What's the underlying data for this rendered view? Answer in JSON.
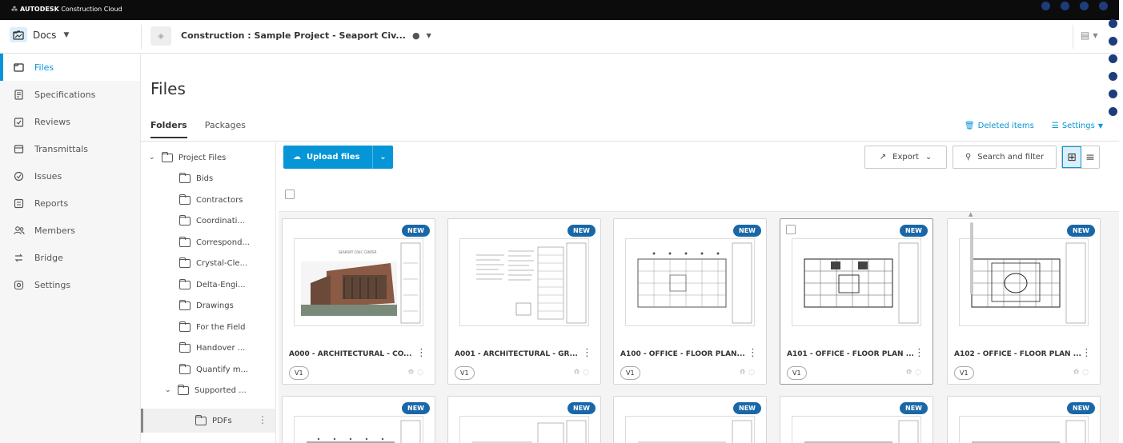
{
  "brand": {
    "mark": "⁂",
    "name": "AUTODESK",
    "product": "Construction Cloud"
  },
  "header": {
    "module_label": "Docs",
    "project_name": "Construction : Sample Project - Seaport Civ...",
    "project_globe_icon": "globe-icon",
    "user_icon": "user-menu-icon"
  },
  "sidebar": {
    "items": [
      {
        "label": "Files",
        "icon": "file-icon",
        "active": true
      },
      {
        "label": "Specifications",
        "icon": "specifications-icon"
      },
      {
        "label": "Reviews",
        "icon": "reviews-icon"
      },
      {
        "label": "Transmittals",
        "icon": "transmittals-icon"
      },
      {
        "label": "Issues",
        "icon": "issues-icon"
      },
      {
        "label": "Reports",
        "icon": "reports-icon"
      },
      {
        "label": "Members",
        "icon": "members-icon"
      },
      {
        "label": "Bridge",
        "icon": "bridge-icon"
      },
      {
        "label": "Settings",
        "icon": "gear-icon"
      }
    ]
  },
  "main": {
    "title": "Files",
    "tabs": [
      {
        "label": "Folders",
        "active": true
      },
      {
        "label": "Packages"
      }
    ],
    "deleted_items": "Deleted items",
    "settings": "Settings"
  },
  "tree": {
    "root": "Project Files",
    "folders": [
      "Bids",
      "Contractors",
      "Coordinati...",
      "Correspond...",
      "Crystal-Cle...",
      "Delta-Engi...",
      "Drawings",
      "For the Field",
      "Handover ...",
      "Quantify m..."
    ],
    "expanded": "Supported ...",
    "child": "PDFs"
  },
  "toolbar": {
    "upload": "Upload files",
    "export": "Export",
    "search": "Search and filter"
  },
  "cards": [
    {
      "name": "A000 - ARCHITECTURAL - CO...",
      "version": "V1",
      "badge": "NEW",
      "thumb": "render"
    },
    {
      "name": "A001 - ARCHITECTURAL - GR...",
      "version": "V1",
      "badge": "NEW",
      "thumb": "notes"
    },
    {
      "name": "A100 - OFFICE - FLOOR PLAN...",
      "version": "V1",
      "badge": "NEW",
      "thumb": "plan"
    },
    {
      "name": "A101 - OFFICE - FLOOR PLAN ...",
      "version": "V1",
      "badge": "NEW",
      "thumb": "plan2"
    },
    {
      "name": "A102 - OFFICE - FLOOR PLAN ...",
      "version": "V1",
      "badge": "NEW",
      "thumb": "plan3"
    }
  ],
  "row2_badges": [
    "NEW",
    "NEW",
    "NEW",
    "NEW",
    "NEW"
  ],
  "sheet_title": "SEAPORT CIVIC CENTER",
  "colors": {
    "accent": "#0696d7",
    "badge": "#1a67a8",
    "dots": "#1d3d7a"
  }
}
